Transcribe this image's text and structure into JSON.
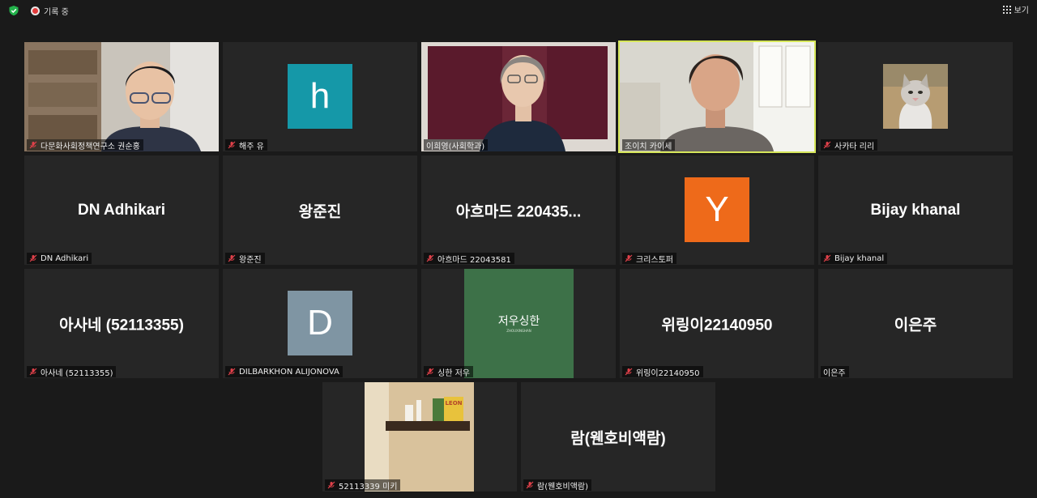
{
  "topbar": {
    "recording_label": "기록 중",
    "view_label": "보기"
  },
  "tiles": [
    {
      "name": "다문화사회정책연구소 권순홍"
    },
    {
      "name": "해주 유",
      "avatar_letter": "h",
      "avatar_color": "#1598a8"
    },
    {
      "name": "이희영(사회학과)"
    },
    {
      "name": "조이치 카이세"
    },
    {
      "name": "사카타 리리"
    },
    {
      "name": "DN Adhikari",
      "display": "DN Adhikari"
    },
    {
      "name": "왕준진",
      "display": "왕준진"
    },
    {
      "name": "아흐마드 22043581",
      "display": "아흐마드 220435..."
    },
    {
      "name": "크리스토퍼",
      "avatar_letter": "Y",
      "avatar_color": "#ee6a1a"
    },
    {
      "name": "Bijay khanal",
      "display": "Bijay khanal"
    },
    {
      "name": "아사네 (52113355)",
      "display": "아사네 (52113355)"
    },
    {
      "name": "DILBARKHON ALIJONOVA",
      "avatar_letter": "D",
      "avatar_color": "#7f95a3"
    },
    {
      "name": "싱한 저우",
      "square_title": "저우싱한",
      "square_sub": "ZHOUXINGHAN",
      "square_color": "#3d7148"
    },
    {
      "name": "위링이22140950",
      "display": "위링이22140950"
    },
    {
      "name": "이은주",
      "display": "이은주"
    },
    {
      "name": "52113339 미키"
    },
    {
      "name": "람(웬호비액람)",
      "display": "람(웬호비액람)"
    }
  ],
  "colors": {
    "background": "#1a1a1a",
    "tile": "#262626",
    "active_speaker": "#d6e65a",
    "muted_mic": "#e0414a"
  }
}
